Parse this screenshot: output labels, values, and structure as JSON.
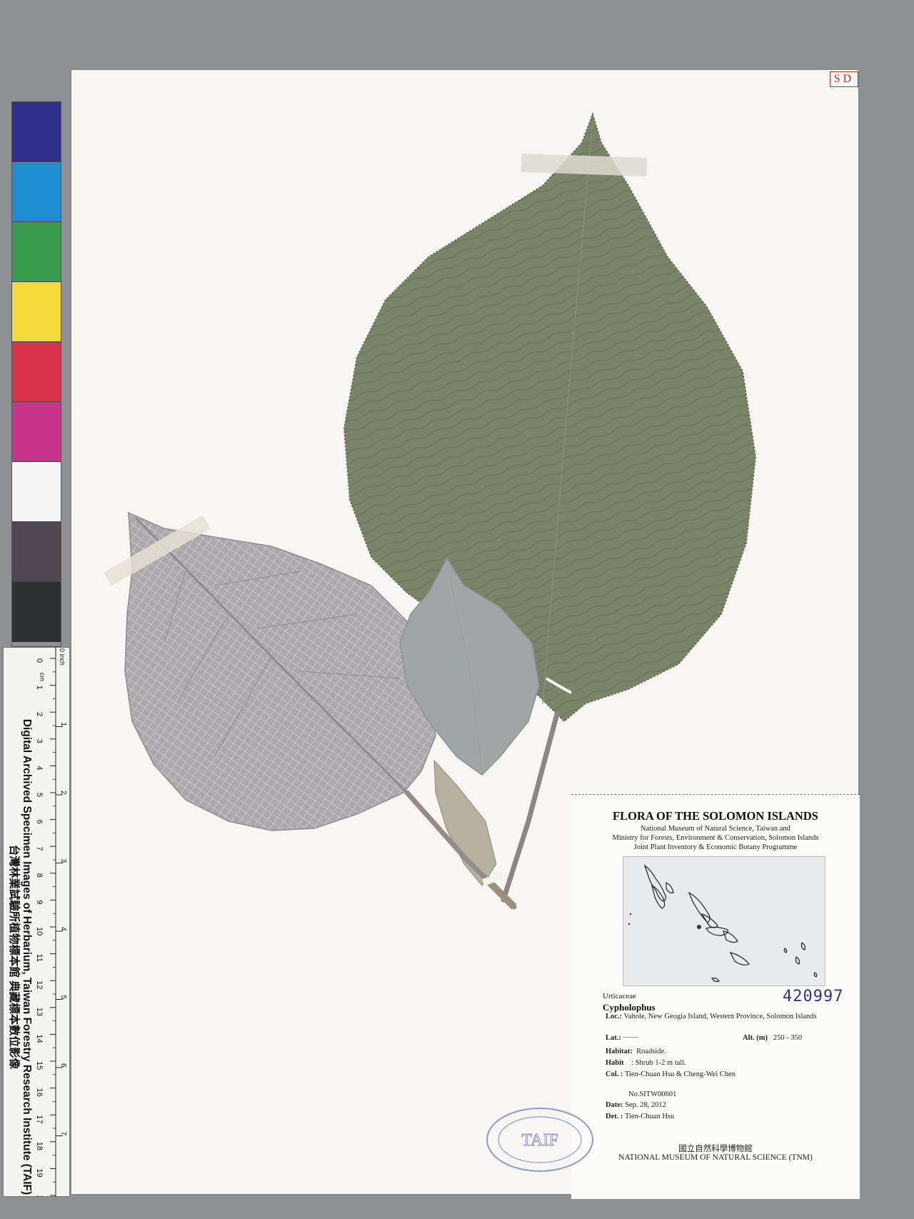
{
  "stamp": {
    "sd": "SD"
  },
  "color_chart": {
    "swatches": [
      "#2f2e8c",
      "#1f8ed0",
      "#3a9a4e",
      "#f3d93a",
      "#d6334a",
      "#c7358a",
      "#f5f5f5",
      "#4e4651",
      "#2f3033"
    ]
  },
  "ruler": {
    "line1": "Digital Archived Specimen Images of Herbarium, Taiwan Forestry Research Institute (TAIF)",
    "line2": "台灣林業試驗所植物標本館 典藏標本數位影像",
    "cm_label": "cm",
    "inch_label": "0 inch",
    "cm_ticks": [
      "0",
      "1",
      "2",
      "3",
      "4",
      "5",
      "6",
      "7",
      "8",
      "9",
      "10",
      "11",
      "12",
      "13",
      "14",
      "15",
      "16",
      "17",
      "18",
      "19",
      "20"
    ],
    "inch_ticks": [
      "1",
      "2",
      "3",
      "4",
      "5",
      "6",
      "7"
    ]
  },
  "label": {
    "title": "FLORA OF THE SOLOMON ISLANDS",
    "subtitle_lines": [
      "National Museum of Natural Science, Taiwan and",
      "Ministry for Forests, Environment & Conservation, Solomon Islands",
      "Joint Plant Inventory & Economic Botany Programme"
    ],
    "family": "Urticaceae",
    "genus": "Cypholophus",
    "catalog_number": "420997",
    "loc_key": "Loc.:",
    "loc_value": "Vahole, New Geogia Island, Western Province, Solomon Islands",
    "lat_key": "Lat.:",
    "alt_key": "Alt. (m)",
    "alt_value": "250 - 350",
    "habitat_key": "Habitat:",
    "habitat_value": "Roadside.",
    "habit_key": "Habit",
    "habit_value": ":  Shrub 1-2 m tall.",
    "col_key": "Col. :",
    "col_value": "Tien-Chuan Hsu & Cheng-Wei Chen",
    "number": "No.SITW00601",
    "date_key": "Date:",
    "date_value": "Sep. 28, 2012",
    "det_key": "Det. :",
    "det_value": "Tien-Chuan Hsu",
    "institution_cn": "國立自然科學博物館",
    "institution_en": "NATIONAL MUSEUM OF NATURAL SCIENCE (TNM)"
  },
  "herbarium_stamp": {
    "text": "TAIF"
  }
}
